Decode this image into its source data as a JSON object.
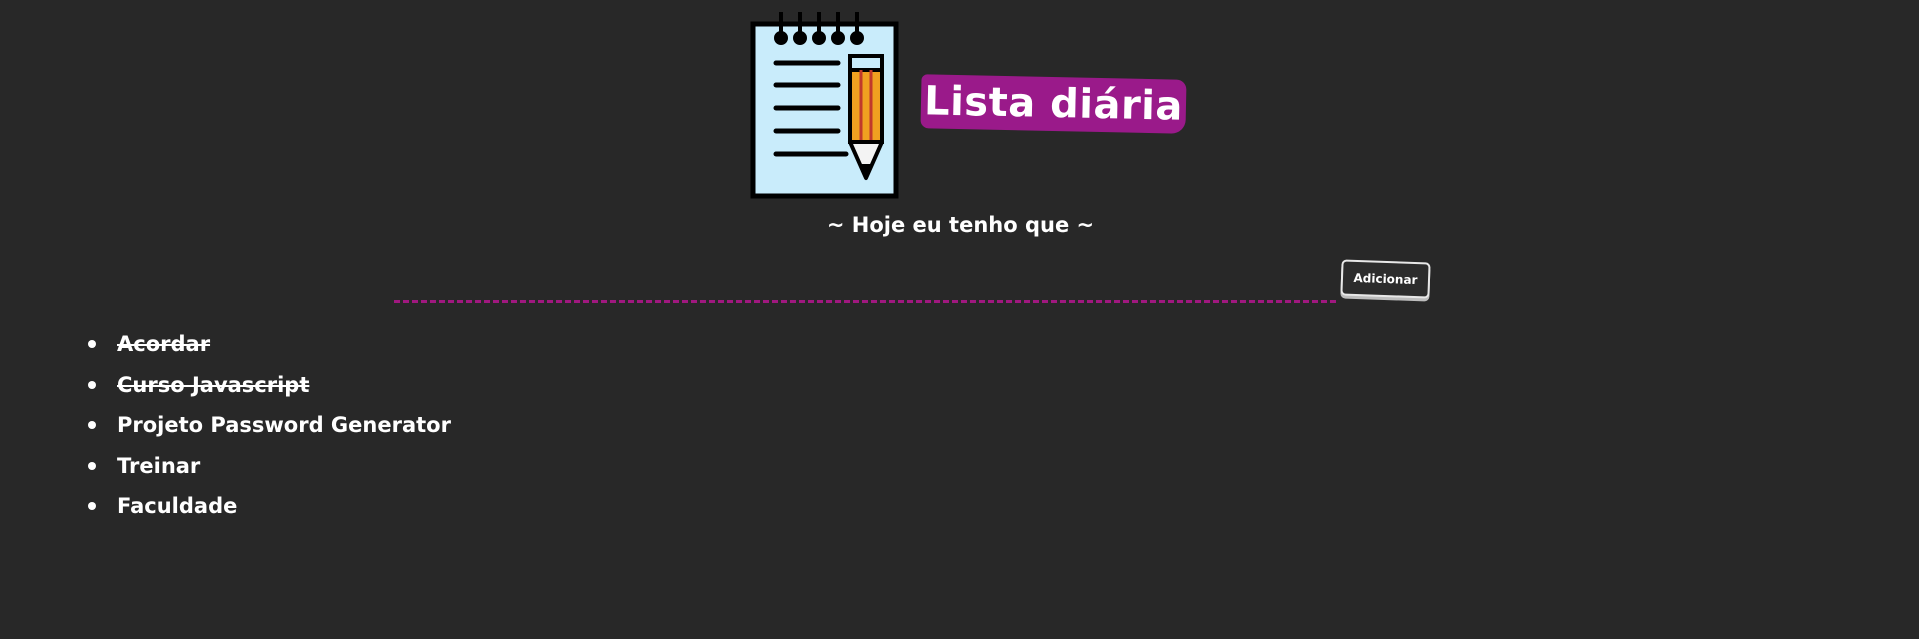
{
  "header": {
    "title": "Lista diária",
    "subtitle": "~ Hoje eu tenho que ~"
  },
  "form": {
    "input_value": "",
    "input_placeholder": "",
    "add_label": "Adicionar"
  },
  "tasks": [
    {
      "text": "Acordar",
      "done": true
    },
    {
      "text": "Curso Javascript",
      "done": true
    },
    {
      "text": "Projeto Password Generator",
      "done": false
    },
    {
      "text": "Treinar",
      "done": false
    },
    {
      "text": "Faculdade",
      "done": false
    }
  ],
  "colors": {
    "background": "#282828",
    "accent": "#9a1a8a",
    "notepad": "#c9ecfb",
    "pencil": "#f0a020"
  }
}
